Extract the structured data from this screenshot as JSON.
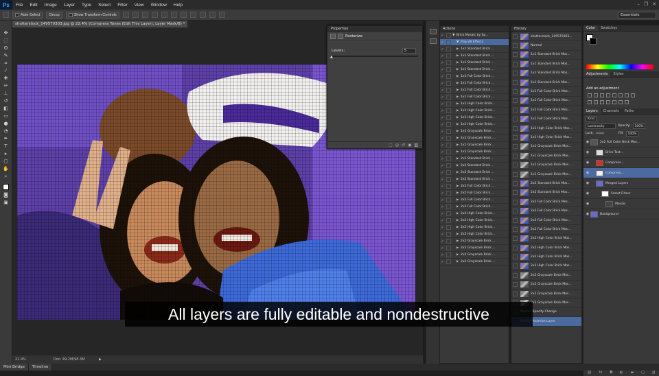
{
  "menubar": {
    "logo": "Ps",
    "items": [
      "File",
      "Edit",
      "Image",
      "Layer",
      "Type",
      "Select",
      "Filter",
      "View",
      "Window",
      "Help"
    ],
    "window_controls": [
      "–",
      "❐",
      "✕"
    ]
  },
  "options_bar": {
    "auto_select": "Auto-Select",
    "auto_select_value": "Group",
    "show_transform": "Show Transform Controls",
    "workspace": "Essentials"
  },
  "document": {
    "tab": "shutterstock_149570303.jpg @ 22.4% (Compress Tones (Edit This Layer), Layer Mask/8) *",
    "zoom": "22.4%",
    "doc_size": "Doc: 49.2M/98.3M"
  },
  "properties": {
    "header": "Properties",
    "title": "Posterize",
    "levels_label": "Levels:",
    "levels_value": "5"
  },
  "actions": {
    "header": "Actions",
    "items": [
      {
        "label": "Brick Mosaic by Sp...",
        "open": true,
        "indent": 0
      },
      {
        "label": "Play All Effects",
        "open": true,
        "indent": 1,
        "selected": true
      },
      {
        "label": "1x1 Standard Brick ...",
        "indent": 1
      },
      {
        "label": "1x1 Standard Brick ...",
        "indent": 1
      },
      {
        "label": "1x1 Standard Brick ...",
        "indent": 1
      },
      {
        "label": "1x1 Standard Brick ...",
        "indent": 1
      },
      {
        "label": "1x1 Full Color Brick ...",
        "indent": 1
      },
      {
        "label": "1x1 Full Color Brick ...",
        "indent": 1
      },
      {
        "label": "1x1 Full Color Brick ...",
        "indent": 1
      },
      {
        "label": "1x1 Full Color Brick ...",
        "indent": 1
      },
      {
        "label": "1x1 High Color Brick...",
        "indent": 1
      },
      {
        "label": "1x1 High Color Brick...",
        "indent": 1
      },
      {
        "label": "1x1 High Color Brick...",
        "indent": 1
      },
      {
        "label": "1x1 High Color Brick...",
        "indent": 1
      },
      {
        "label": "1x1 Grayscale Brick ...",
        "indent": 1
      },
      {
        "label": "1x1 Grayscale Brick ...",
        "indent": 1
      },
      {
        "label": "1x1 Grayscale Brick ...",
        "indent": 1
      },
      {
        "label": "1x1 Grayscale Brick ...",
        "indent": 1
      },
      {
        "label": "2x2 Standard Brick ...",
        "indent": 1
      },
      {
        "label": "2x2 Standard Brick ...",
        "indent": 1
      },
      {
        "label": "2x2 Standard Brick ...",
        "indent": 1
      },
      {
        "label": "2x2 Standard Brick ...",
        "indent": 1
      },
      {
        "label": "2x2 Full Color Brick ...",
        "indent": 1
      },
      {
        "label": "2x2 Full Color Brick ...",
        "indent": 1
      },
      {
        "label": "2x2 Full Color Brick ...",
        "indent": 1
      },
      {
        "label": "2x2 Full Color Brick ...",
        "indent": 1
      },
      {
        "label": "2x2 High Color Brick...",
        "indent": 1
      },
      {
        "label": "2x2 High Color Brick...",
        "indent": 1
      },
      {
        "label": "2x2 High Color Brick...",
        "indent": 1
      },
      {
        "label": "2x2 High Color Brick...",
        "indent": 1
      },
      {
        "label": "2x2 Grayscale Brick ...",
        "indent": 1
      },
      {
        "label": "2x2 Grayscale Brick ...",
        "indent": 1
      },
      {
        "label": "2x2 Grayscale Brick ...",
        "indent": 1
      },
      {
        "label": "2x2 Grayscale Brick ...",
        "indent": 1
      }
    ]
  },
  "history": {
    "header": "History",
    "items": [
      {
        "label": "shutterstock_149570303..."
      },
      {
        "label": "Normal"
      },
      {
        "label": "1x1 Standard Brick Mos..."
      },
      {
        "label": "1x1 Standard Brick Mos..."
      },
      {
        "label": "1x1 Standard Brick Mos..."
      },
      {
        "label": "1x1 Standard Brick Mos..."
      },
      {
        "label": "1x1 Full Color Brick Mos..."
      },
      {
        "label": "1x1 Full Color Brick Mos..."
      },
      {
        "label": "1x1 Full Color Brick Mos..."
      },
      {
        "label": "1x1 Full Color Brick Mos..."
      },
      {
        "label": "1x1 High Color Brick Mos..."
      },
      {
        "label": "1x1 High Color Brick Mos..."
      },
      {
        "label": "1x1 Grayscale Brick Mos...",
        "gray": true
      },
      {
        "label": "1x1 Grayscale Brick Mos...",
        "gray": true
      },
      {
        "label": "1x1 Grayscale Brick Mos...",
        "gray": true
      },
      {
        "label": "1x1 Grayscale Brick Mos...",
        "gray": true
      },
      {
        "label": "2x2 Standard Brick Mos..."
      },
      {
        "label": "2x2 Standard Brick Mos..."
      },
      {
        "label": "2x2 Full Color Brick Mos..."
      },
      {
        "label": "2x2 Full Color Brick Mos..."
      },
      {
        "label": "2x2 Full Color Brick Mos..."
      },
      {
        "label": "2x2 Full Color Brick Mos..."
      },
      {
        "label": "2x2 High Color Brick Mos..."
      },
      {
        "label": "2x2 High Color Brick Mos..."
      },
      {
        "label": "2x2 High Color Brick Mos..."
      },
      {
        "label": "2x2 High Color Brick Mos..."
      },
      {
        "label": "2x2 Grayscale Brick Mos...",
        "gray": true
      },
      {
        "label": "2x2 Grayscale Brick Mos...",
        "gray": true
      },
      {
        "label": "2x2 Grayscale Brick Mos...",
        "gray": true
      },
      {
        "label": "2x2 Grayscale Brick Mos...",
        "gray": true
      },
      {
        "label": "Master Opacity Change",
        "nothumb": true
      },
      {
        "label": "Modify Posterize Layer",
        "nothumb": true,
        "selected": true
      }
    ]
  },
  "color_panel": {
    "tabs": [
      "Color",
      "Swatches"
    ]
  },
  "adjustments_panel": {
    "tabs": [
      "Adjustments",
      "Styles"
    ],
    "label": "Add an adjustment"
  },
  "layers_panel": {
    "tabs": [
      "Layers",
      "Channels",
      "Paths"
    ],
    "kind": "Kind",
    "blend": "Luminosity",
    "opacity_label": "Opacity:",
    "opacity": "100%",
    "lock_label": "Lock:",
    "fill_label": "Fill:",
    "fill": "100%",
    "layers": [
      {
        "label": "2x2 Full Color Brick Mos...",
        "color": "#555"
      },
      {
        "label": "Brick Text...",
        "color": "#ddd"
      },
      {
        "label": "Compress...",
        "color": "#d03030"
      },
      {
        "label": "Compress...",
        "color": "#eee",
        "selected": true
      },
      {
        "label": "Merged Layers",
        "color": "#6a6ad0"
      },
      {
        "label": "Smart Filters",
        "color": "#fff"
      },
      {
        "label": "Mosaic",
        "color": "#444"
      },
      {
        "label": "Background",
        "color": "#6a6ad0"
      }
    ]
  },
  "bottom_tabs": [
    "Mini Bridge",
    "Timeline"
  ],
  "caption": "All layers are fully editable and nondestructive"
}
